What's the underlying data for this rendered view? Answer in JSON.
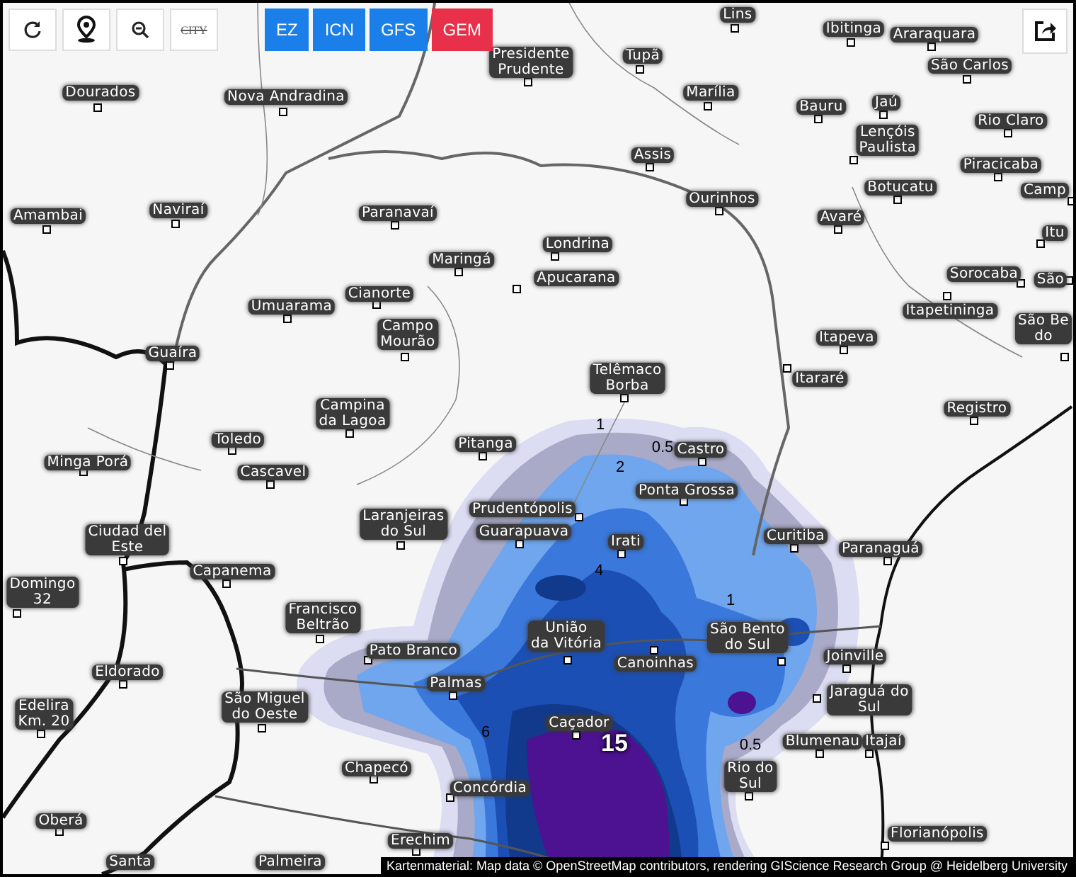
{
  "toolbar": {
    "buttons": [
      {
        "kind": "refresh"
      },
      {
        "kind": "pin"
      },
      {
        "kind": "zoom-out"
      },
      {
        "kind": "city",
        "label": "CITY",
        "on": false
      }
    ]
  },
  "models": [
    {
      "label": "EZ",
      "selected": false
    },
    {
      "label": "ICN",
      "selected": false
    },
    {
      "label": "GFS",
      "selected": false
    },
    {
      "label": "GEM",
      "selected": true
    }
  ],
  "cities": [
    {
      "name": "Dourados"
    },
    {
      "name": "Nova Andradina"
    },
    {
      "name": "Presidente\nPrudente"
    },
    {
      "name": "Tupã"
    },
    {
      "name": "Lins"
    },
    {
      "name": "Ibitinga"
    },
    {
      "name": "Araraquara"
    },
    {
      "name": "São Carlos"
    },
    {
      "name": "Marília"
    },
    {
      "name": "Bauru"
    },
    {
      "name": "Jaú"
    },
    {
      "name": "Lençóis\nPaulista"
    },
    {
      "name": "Rio Claro"
    },
    {
      "name": "Assis"
    },
    {
      "name": "Piracicaba"
    },
    {
      "name": "Botucatu"
    },
    {
      "name": "Ourinhos"
    },
    {
      "name": "Avaré"
    },
    {
      "name": "Camp"
    },
    {
      "name": "Itu"
    },
    {
      "name": "Londrina"
    },
    {
      "name": "Apucarana"
    },
    {
      "name": "Sorocaba"
    },
    {
      "name": "São"
    },
    {
      "name": "Itapetininga"
    },
    {
      "name": "Amambai"
    },
    {
      "name": "Naviraí"
    },
    {
      "name": "Paranavaí"
    },
    {
      "name": "Maringá"
    },
    {
      "name": "Cianorte"
    },
    {
      "name": "Umuarama"
    },
    {
      "name": "Campo\nMourão"
    },
    {
      "name": "Guaíra"
    },
    {
      "name": "Campina\nda Lagoa"
    },
    {
      "name": "Telêmaco\nBorba"
    },
    {
      "name": "Itapeva"
    },
    {
      "name": "Itararé"
    },
    {
      "name": "Registro"
    },
    {
      "name": "São Be\ndo"
    },
    {
      "name": "Toledo"
    },
    {
      "name": "Cascavel"
    },
    {
      "name": "Pitanga"
    },
    {
      "name": "Minga Porá"
    },
    {
      "name": "Castro"
    },
    {
      "name": "Ponta Grossa"
    },
    {
      "name": "Prudentópolis"
    },
    {
      "name": "Laranjeiras\ndo Sul"
    },
    {
      "name": "Ciudad del\nEste"
    },
    {
      "name": "Guarapuava"
    },
    {
      "name": "Curitiba"
    },
    {
      "name": "Paranaguá"
    },
    {
      "name": "Irati"
    },
    {
      "name": "Capanema"
    },
    {
      "name": "Domingo\n32"
    },
    {
      "name": "Francisco\nBeltrão"
    },
    {
      "name": "União\nda Vitória"
    },
    {
      "name": "São Bento\ndo Sul"
    },
    {
      "name": "Canoinhas"
    },
    {
      "name": "Joinville"
    },
    {
      "name": "Pato Branco"
    },
    {
      "name": "Jaraguá do\nSul"
    },
    {
      "name": "Palmas"
    },
    {
      "name": "Eldorado"
    },
    {
      "name": "Edelira\nKm. 20"
    },
    {
      "name": "São Miguel\ndo Oeste"
    },
    {
      "name": "Caçador"
    },
    {
      "name": "Blumenau"
    },
    {
      "name": "Itajaí"
    },
    {
      "name": "Chapecó"
    },
    {
      "name": "Concórdia"
    },
    {
      "name": "Rio do\nSul"
    },
    {
      "name": "Oberá"
    },
    {
      "name": "Erechim"
    },
    {
      "name": "Florianópolis"
    },
    {
      "name": "Santa"
    },
    {
      "name": "Palmeira"
    }
  ],
  "contour_labels": [
    {
      "text": "1",
      "kind": "small"
    },
    {
      "text": "0.5",
      "kind": "small"
    },
    {
      "text": "2",
      "kind": "small"
    },
    {
      "text": "4",
      "kind": "small"
    },
    {
      "text": "1",
      "kind": "small"
    },
    {
      "text": "0.5",
      "kind": "small"
    },
    {
      "text": "6",
      "kind": "small"
    },
    {
      "text": "15",
      "kind": "big"
    }
  ],
  "attribution": "Kartenmaterial: Map data © OpenStreetMap contributors, rendering GIScience Research Group @ Heidelberg University"
}
